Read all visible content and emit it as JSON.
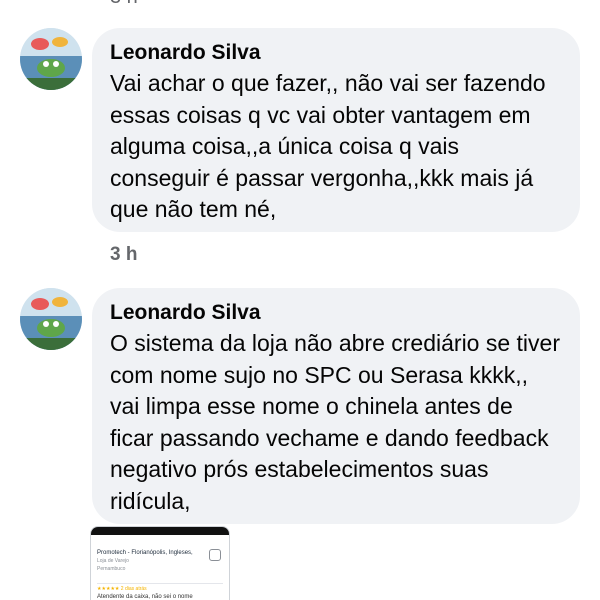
{
  "top_cut_text": "3 h",
  "comments": [
    {
      "author": "Leonardo Silva",
      "text": "Vai achar o que fazer,, não vai ser fazendo essas coisas q vc vai obter vantagem em alguma coisa,,a única coisa q vais conseguir é passar vergonha,,kkk mais já que não tem né,",
      "time": "3 h"
    },
    {
      "author": "Leonardo Silva",
      "text": "O sistema da loja não abre crediário se tiver com nome sujo no SPC ou Serasa kkkk,, vai limpa esse nome o chinela antes de ficar passando vechame e dando feedback negativo prós estabelecimentos suas ridícula,"
    }
  ],
  "attachment": {
    "title": "Promotech - Florianópolis, Ingleses,",
    "sub1": "Loja de Varejo",
    "sub2": "Pernambuco",
    "stars": "★★★★★  2 dias atrás",
    "snippet": "Atendente da caixa, não sei o nome"
  }
}
